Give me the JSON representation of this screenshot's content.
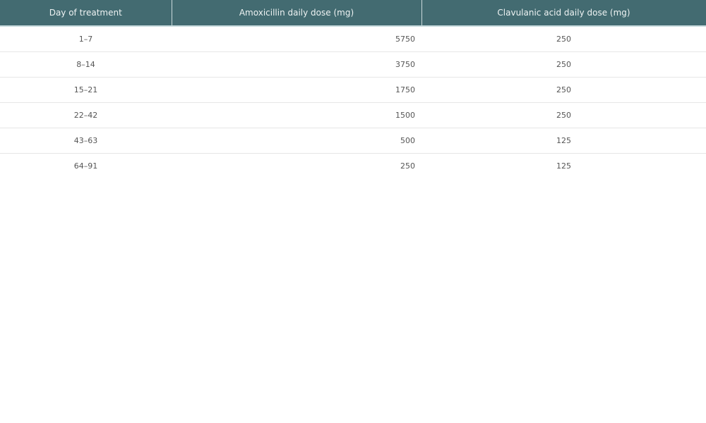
{
  "table": {
    "headers": [
      "Day of treatment",
      "Amoxicillin daily dose (mg)",
      "Clavulanic acid daily dose (mg)"
    ],
    "rows": [
      {
        "day": "1–7",
        "amoxicillin": "5750",
        "clavulanic": "250"
      },
      {
        "day": "8–14",
        "amoxicillin": "3750",
        "clavulanic": "250"
      },
      {
        "day": "15–21",
        "amoxicillin": "1750",
        "clavulanic": "250"
      },
      {
        "day": "22–42",
        "amoxicillin": "1500",
        "clavulanic": "250"
      },
      {
        "day": "43–63",
        "amoxicillin": "500",
        "clavulanic": "125"
      },
      {
        "day": "64–91",
        "amoxicillin": "250",
        "clavulanic": "125"
      }
    ]
  },
  "colors": {
    "header_background": "#436b71",
    "header_text": "#eef3f3",
    "row_divider": "#e6e6e6"
  }
}
